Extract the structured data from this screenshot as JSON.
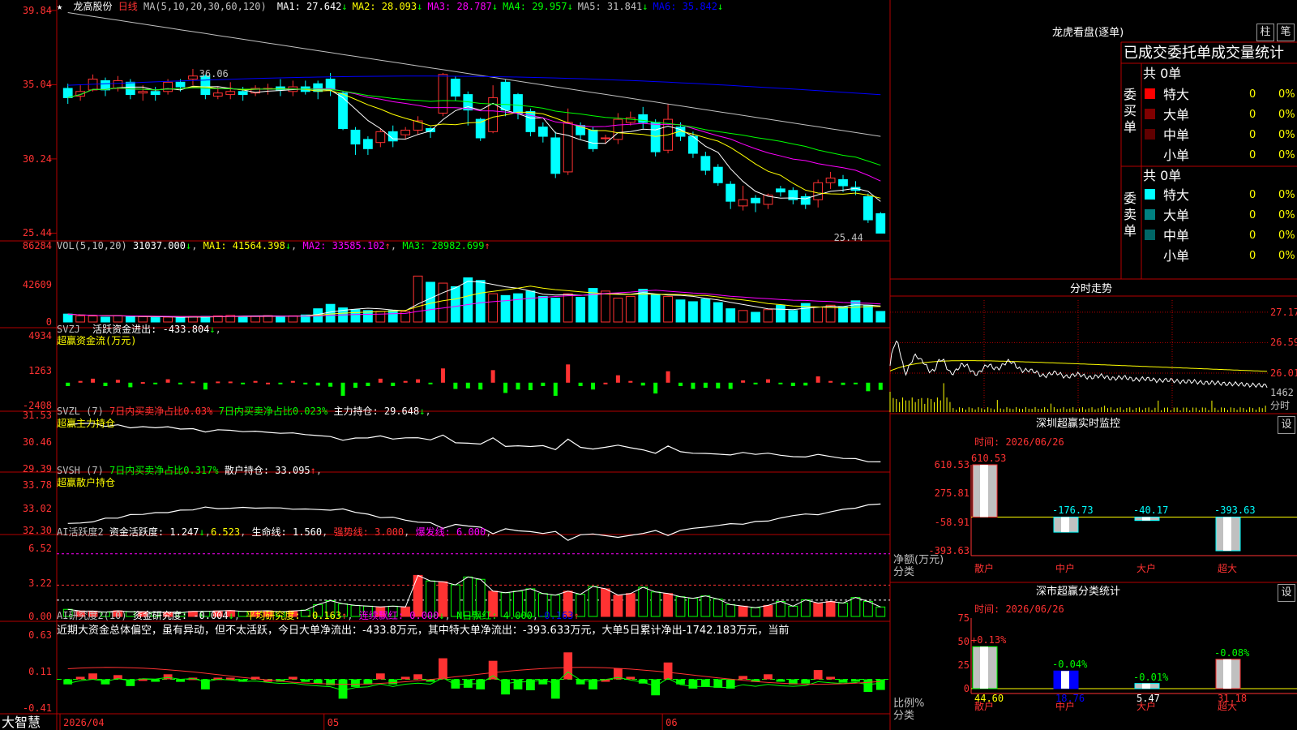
{
  "colors": {
    "up": "#ff3232",
    "down": "#00ffff",
    "ma1": "#ffffff",
    "ma2": "#ffff00",
    "ma3": "#ff00ff",
    "ma4": "#00ff00",
    "ma5": "#c0c0c0",
    "ma6": "#0000ff",
    "grid": "#b40000",
    "text": "#c0c0c0",
    "green": "#00ff00",
    "bg": "#000000"
  },
  "icons": {
    "star": "★"
  },
  "main": {
    "stock_name": "龙高股份",
    "period": "日线",
    "ma_params": "MA(5,10,20,30,60,120)",
    "ma_items": [
      {
        "label": "MA1: 27.642",
        "arrow": "↓",
        "color": "#ffffff"
      },
      {
        "label": "MA2: 28.093",
        "arrow": "↓",
        "color": "#ffff00"
      },
      {
        "label": "MA3: 28.787",
        "arrow": "↓",
        "color": "#ff00ff"
      },
      {
        "label": "MA4: 29.957",
        "arrow": "↓",
        "color": "#00ff00"
      },
      {
        "label": "MA5: 31.841",
        "arrow": "↓",
        "color": "#c0c0c0"
      },
      {
        "label": "MA6: 35.842",
        "arrow": "↓",
        "color": "#0000ff"
      }
    ],
    "y_ticks": [
      "39.84",
      "35.04",
      "30.24",
      "25.44"
    ],
    "high_label": "36.06",
    "low_label": "25.44"
  },
  "vol": {
    "title": "VOL(5,10,20)",
    "value": "31037.000",
    "ma1": "MA1: 41564.398",
    "ma2": "MA2: 33585.102",
    "ma3": "MA3: 28982.699",
    "y_ticks": [
      "86284",
      "42609",
      "0"
    ]
  },
  "svzj": {
    "title": "SVZJ",
    "label": "活跃资金进出: -433.804",
    "sub": "超赢资金流(万元)",
    "y_ticks": [
      "4934",
      "1263",
      "-2408"
    ]
  },
  "svzl": {
    "title": "SVZL (7)",
    "t1": "7日内买卖净占比0.03%",
    "t2": "7日内买卖净占比0.023%",
    "t3": "主力持仓: 29.648",
    "sub": "超赢主力持仓",
    "y_ticks": [
      "31.53",
      "30.46",
      "29.39"
    ]
  },
  "svsh": {
    "title": "SVSH (7)",
    "t1": "7日内买卖净占比0.317%",
    "t2": "散户持仓: 33.095",
    "sub": "超赢散户持仓",
    "y_ticks": [
      "33.78",
      "33.02",
      "32.30"
    ]
  },
  "ai1": {
    "title": "AI活跃度2",
    "t1": "资金活跃度: 1.247",
    "t2": "6.523",
    "t3": "生命线: 1.560",
    "t4": "强势线: 3.000",
    "t5": "爆发线: 6.000",
    "y_ticks": [
      "6.52",
      "3.22",
      "0.00"
    ]
  },
  "ai2": {
    "title": "AI研究度2(10)",
    "t1": "资金研究度: -0.004",
    "t2": "平均研究度: -0.163",
    "t3": "连续飘红: 0.000",
    "t4": "N日飘红: 4.000",
    "t5": "-0.163",
    "comment": "近期大资金总体偏空，虽有异动，但不太活跃，今日大单净流出：-433.8万元，其中特大单净流出：-393.633万元，大单5日累计净出-1742.183万元，当前",
    "y_ticks": [
      "0.63",
      "0.11",
      "-0.41"
    ]
  },
  "xaxis": {
    "labels": [
      "2026/04",
      "05",
      "06"
    ]
  },
  "brand": "大智慧",
  "right": {
    "dragon": {
      "title": "龙虎看盘(逐单)",
      "btn1": "柱",
      "btn2": "笔",
      "header": "已成交委托单成交量统计",
      "buy": {
        "group": "委买单",
        "total": "共 0单",
        "rows": [
          {
            "label": "特大",
            "value": "0",
            "pct": "0%",
            "color": "#ff0000"
          },
          {
            "label": "大单",
            "value": "0",
            "pct": "0%",
            "color": "#800000"
          },
          {
            "label": "中单",
            "value": "0",
            "pct": "0%",
            "color": "#600000"
          },
          {
            "label": "小单",
            "value": "0",
            "pct": "0%",
            "color": "#000000"
          }
        ]
      },
      "sell": {
        "group": "委卖单",
        "total": "共 0单",
        "rows": [
          {
            "label": "特大",
            "value": "0",
            "pct": "0%",
            "color": "#00ffff"
          },
          {
            "label": "大单",
            "value": "0",
            "pct": "0%",
            "color": "#008080"
          },
          {
            "label": "中单",
            "value": "0",
            "pct": "0%",
            "color": "#006666"
          },
          {
            "label": "小单",
            "value": "0",
            "pct": "0%",
            "color": "#000000"
          }
        ]
      }
    },
    "minute": {
      "title": "分时走势",
      "y_ticks": [
        "27.17",
        "26.59",
        "26.01"
      ],
      "vol_tick": "1462",
      "vol_label": "分时"
    },
    "sz_monitor": {
      "title": "深圳超赢实时监控",
      "btn": "设",
      "time": "时间: 2026/06/26",
      "y_ticks": [
        "610.53",
        "275.81",
        "-58.91",
        "-393.63"
      ],
      "ylabel1": "净额(万元)",
      "ylabel2": "分类",
      "bars": [
        {
          "cat": "散户",
          "value": 610.53,
          "label": "610.53"
        },
        {
          "cat": "中户",
          "value": -176.73,
          "label": "-176.73"
        },
        {
          "cat": "大户",
          "value": -40.17,
          "label": "-40.17"
        },
        {
          "cat": "超大",
          "value": -393.63,
          "label": "-393.63"
        }
      ]
    },
    "sz_class": {
      "title": "深市超赢分类统计",
      "btn": "设",
      "time": "时间: 2026/06/26",
      "y_ticks": [
        "75",
        "50",
        "25",
        "0"
      ],
      "ylabel1": "比例%",
      "ylabel2": "分类",
      "bars": [
        {
          "cat": "散户",
          "value": 44.6,
          "label": "44.60",
          "delta": "+0.13%"
        },
        {
          "cat": "中户",
          "value": 18.76,
          "label": "18.76",
          "delta": "-0.04%"
        },
        {
          "cat": "大户",
          "value": 5.47,
          "label": "5.47",
          "delta": "-0.01%"
        },
        {
          "cat": "超大",
          "value": 31.18,
          "label": "31.18",
          "delta": "-0.08%"
        }
      ]
    }
  },
  "chart_data": {
    "type": "candlestick",
    "dates_range": [
      "2026/04",
      "2026/06"
    ],
    "candles": [
      [
        34.8,
        34.2,
        35.1,
        33.8
      ],
      [
        34.3,
        34.6,
        35.0,
        34.0
      ],
      [
        34.7,
        35.4,
        35.7,
        34.6
      ],
      [
        35.3,
        34.7,
        35.5,
        34.3
      ],
      [
        34.8,
        35.3,
        35.6,
        34.6
      ],
      [
        35.2,
        34.4,
        35.4,
        34.1
      ],
      [
        34.5,
        34.6,
        35.0,
        34.0
      ],
      [
        34.6,
        34.4,
        34.9,
        34.0
      ],
      [
        34.6,
        35.2,
        35.4,
        34.4
      ],
      [
        35.2,
        34.9,
        35.4,
        34.6
      ],
      [
        35.4,
        35.6,
        36.06,
        35.0
      ],
      [
        35.6,
        34.4,
        35.7,
        34.1
      ],
      [
        34.3,
        34.5,
        34.9,
        34.1
      ],
      [
        34.4,
        34.6,
        35.2,
        34.1
      ],
      [
        34.6,
        34.4,
        34.9,
        34.0
      ],
      [
        34.5,
        34.8,
        35.0,
        34.3
      ],
      [
        34.8,
        34.8,
        35.1,
        34.4
      ],
      [
        34.9,
        34.7,
        35.4,
        34.3
      ],
      [
        34.6,
        34.9,
        35.3,
        34.3
      ],
      [
        34.9,
        34.6,
        35.3,
        34.4
      ],
      [
        35.1,
        34.6,
        35.3,
        34.1
      ],
      [
        35.4,
        34.7,
        35.8,
        34.3
      ],
      [
        34.5,
        32.2,
        34.6,
        32.1
      ],
      [
        32.1,
        31.2,
        32.3,
        30.5
      ],
      [
        31.5,
        30.9,
        31.7,
        30.5
      ],
      [
        31.3,
        32.0,
        32.2,
        31.0
      ],
      [
        32.0,
        31.4,
        32.4,
        31.0
      ],
      [
        31.8,
        32.1,
        32.3,
        31.5
      ],
      [
        32.1,
        32.7,
        33.0,
        31.8
      ],
      [
        32.2,
        32.0,
        32.3,
        31.6
      ],
      [
        33.2,
        35.7,
        35.8,
        33.0
      ],
      [
        35.4,
        34.3,
        35.6,
        34.0
      ],
      [
        34.4,
        33.4,
        34.6,
        32.4
      ],
      [
        32.8,
        31.6,
        32.9,
        31.4
      ],
      [
        32.0,
        34.2,
        35.0,
        31.9
      ],
      [
        35.2,
        33.4,
        35.4,
        33.0
      ],
      [
        34.4,
        33.2,
        34.5,
        32.8
      ],
      [
        33.3,
        32.0,
        33.5,
        31.7
      ],
      [
        32.3,
        31.7,
        32.6,
        31.3
      ],
      [
        31.6,
        29.3,
        32.0,
        29.0
      ],
      [
        29.4,
        32.6,
        33.5,
        29.2
      ],
      [
        32.4,
        31.8,
        32.6,
        31.5
      ],
      [
        32.1,
        30.9,
        32.3,
        30.7
      ],
      [
        31.6,
        31.6,
        31.8,
        31.2
      ],
      [
        31.5,
        32.8,
        33.2,
        31.2
      ],
      [
        32.6,
        32.9,
        33.3,
        32.4
      ],
      [
        33.1,
        32.6,
        33.6,
        32.2
      ],
      [
        32.6,
        30.7,
        32.8,
        30.4
      ],
      [
        30.8,
        32.8,
        33.8,
        30.6
      ],
      [
        32.3,
        31.7,
        32.6,
        31.4
      ],
      [
        31.7,
        30.6,
        32.0,
        30.3
      ],
      [
        30.4,
        29.5,
        30.7,
        29.2
      ],
      [
        29.7,
        28.7,
        29.9,
        28.5
      ],
      [
        28.6,
        27.5,
        28.8,
        27.0
      ],
      [
        27.2,
        27.6,
        28.5,
        26.9
      ],
      [
        27.7,
        27.4,
        27.9,
        26.8
      ],
      [
        27.3,
        27.9,
        28.0,
        27.0
      ],
      [
        28.3,
        28.1,
        28.5,
        27.8
      ],
      [
        28.2,
        27.6,
        28.4,
        27.3
      ],
      [
        27.8,
        27.3,
        28.0,
        27.0
      ],
      [
        27.6,
        28.7,
        28.9,
        27.1
      ],
      [
        28.7,
        29.0,
        29.4,
        28.3
      ],
      [
        28.9,
        28.5,
        29.2,
        28.1
      ],
      [
        28.4,
        28.2,
        28.8,
        27.9
      ],
      [
        27.8,
        26.3,
        28.0,
        26.1
      ],
      [
        26.7,
        25.44,
        26.8,
        25.44
      ]
    ],
    "volume": [
      9000,
      7000,
      6800,
      5500,
      7200,
      5900,
      6100,
      5000,
      5500,
      4800,
      6400,
      6500,
      7000,
      7500,
      6400,
      6800,
      7200,
      6000,
      7000,
      8000,
      15000,
      20000,
      16000,
      14000,
      13000,
      12000,
      13000,
      12000,
      52000,
      45000,
      44000,
      40000,
      50000,
      47000,
      32000,
      30000,
      32000,
      35000,
      29000,
      27000,
      32000,
      28000,
      38000,
      35000,
      27000,
      29000,
      37000,
      31000,
      29000,
      25000,
      23000,
      26000,
      22000,
      15000,
      13000,
      11000,
      14000,
      19000,
      13000,
      21000,
      17000,
      19000,
      17000,
      24000,
      19000,
      12000,
      20000,
      36000,
      34000,
      38000,
      30000,
      31000
    ],
    "volume_ticks": [
      "86284",
      "42609",
      "0"
    ],
    "svzj_ticks": [
      "4934",
      "1263",
      "-2408"
    ],
    "svzl_ticks": [
      "31.53",
      "30.46",
      "29.39"
    ],
    "svsh_ticks": [
      "33.78",
      "33.02",
      "32.30"
    ],
    "ai1_ticks": [
      "6.52",
      "3.22",
      "0.00"
    ],
    "ai2_ticks": [
      "0.63",
      "0.11",
      "-0.41"
    ]
  }
}
